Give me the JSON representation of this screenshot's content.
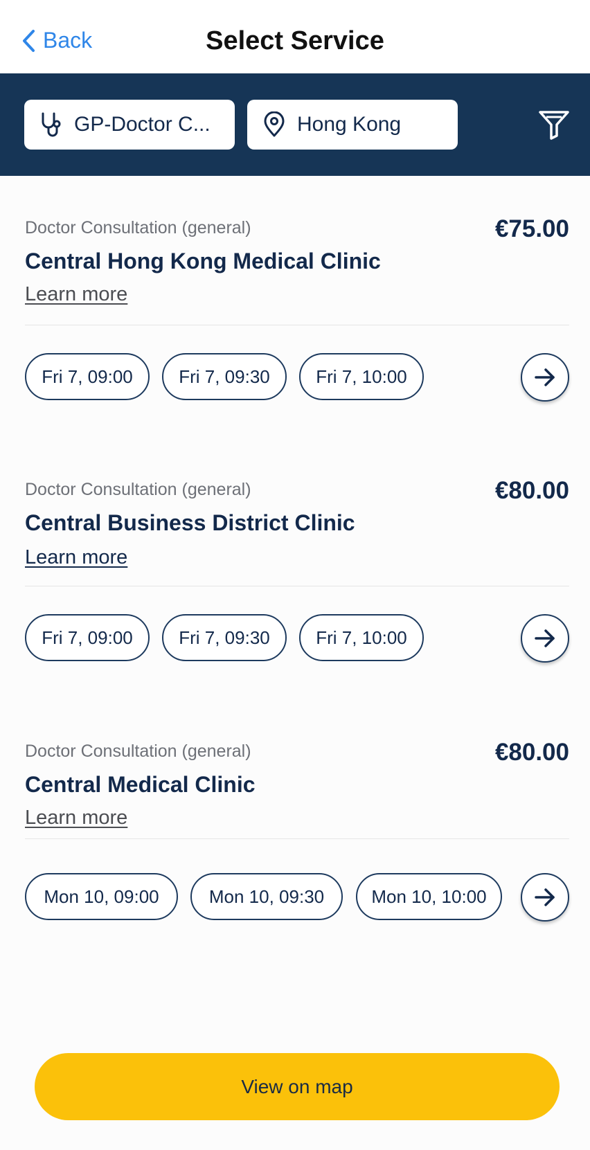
{
  "header": {
    "back_label": "Back",
    "title": "Select Service"
  },
  "filters": {
    "service": "GP-Doctor C...",
    "location": "Hong Kong"
  },
  "listings": [
    {
      "category": "Doctor Consultation (general)",
      "clinic": "Central Hong Kong Medical Clinic",
      "price": "€75.00",
      "learn_more": "Learn more",
      "slots": [
        "Fri 7, 09:00",
        "Fri 7, 09:30",
        "Fri 7, 10:00"
      ]
    },
    {
      "category": "Doctor Consultation (general)",
      "clinic": "Central Business District Clinic",
      "price": "€80.00",
      "learn_more": "Learn more",
      "slots": [
        "Fri 7, 09:00",
        "Fri 7, 09:30",
        "Fri 7, 10:00"
      ]
    },
    {
      "category": "Doctor Consultation (general)",
      "clinic": "Central Medical Clinic",
      "price": "€80.00",
      "learn_more": "Learn more",
      "slots": [
        "Mon 10, 09:00",
        "Mon 10, 09:30",
        "Mon 10, 10:00"
      ]
    }
  ],
  "footer": {
    "map_button": "View on map"
  },
  "colors": {
    "navy": "#163556",
    "accent_blue": "#2f86e8",
    "map_button": "#fbc10a"
  },
  "icons": {
    "back": "chevron-left-icon",
    "service": "stethoscope-icon",
    "location": "map-pin-icon",
    "filter": "filter-icon",
    "next": "arrow-right-icon"
  }
}
